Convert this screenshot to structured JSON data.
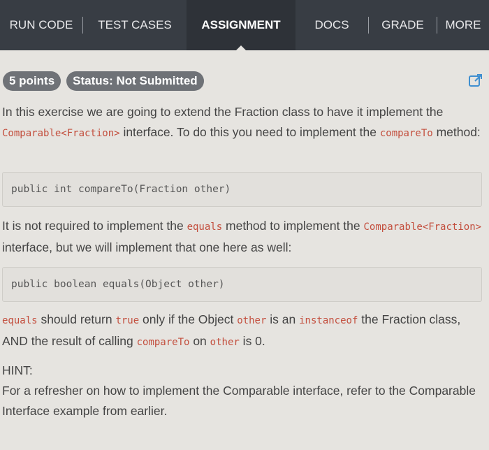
{
  "tabs": [
    {
      "label": "RUN CODE"
    },
    {
      "label": "TEST CASES"
    },
    {
      "label": "ASSIGNMENT"
    },
    {
      "label": "DOCS"
    },
    {
      "label": "GRADE"
    },
    {
      "label": "MORE"
    }
  ],
  "header": {
    "points": "5 points",
    "status": "Status: Not Submitted",
    "open_icon": "external-link-icon"
  },
  "content": {
    "p1": {
      "t1": "In this exercise we are going to extend the Fraction class to have it implement the ",
      "c1": "Comparable<Fraction>",
      "t2": " interface. To do this you need to implement the ",
      "c2": "compareTo",
      "t3": " method:"
    },
    "code1": "public int compareTo(Fraction other)",
    "p2": {
      "t1": "It is not required to implement the ",
      "c1": "equals",
      "t2": " method to implement the ",
      "c2": "Comparable<Fraction>",
      "t3": " interface, but we will implement that one here as well:"
    },
    "code2": "public boolean equals(Object other)",
    "p3": {
      "c1": "equals",
      "t1": " should return ",
      "c2": "true",
      "t2": " only if the Object ",
      "c3": "other",
      "t3": " is an ",
      "c4": "instanceof",
      "t4": " the Fraction class, AND the result of calling ",
      "c5": "compareTo",
      "t5": " on ",
      "c6": "other",
      "t6": " is 0."
    },
    "hint_label": "HINT:",
    "hint_text": "For a refresher on how to implement the Comparable interface, refer to the Comparable Interface example from earlier."
  },
  "colors": {
    "tabbar": "#383d44",
    "active_tab": "#2e3238",
    "badge": "#6f7277",
    "code_text": "#c34e3d",
    "background": "#e6e4e0"
  }
}
